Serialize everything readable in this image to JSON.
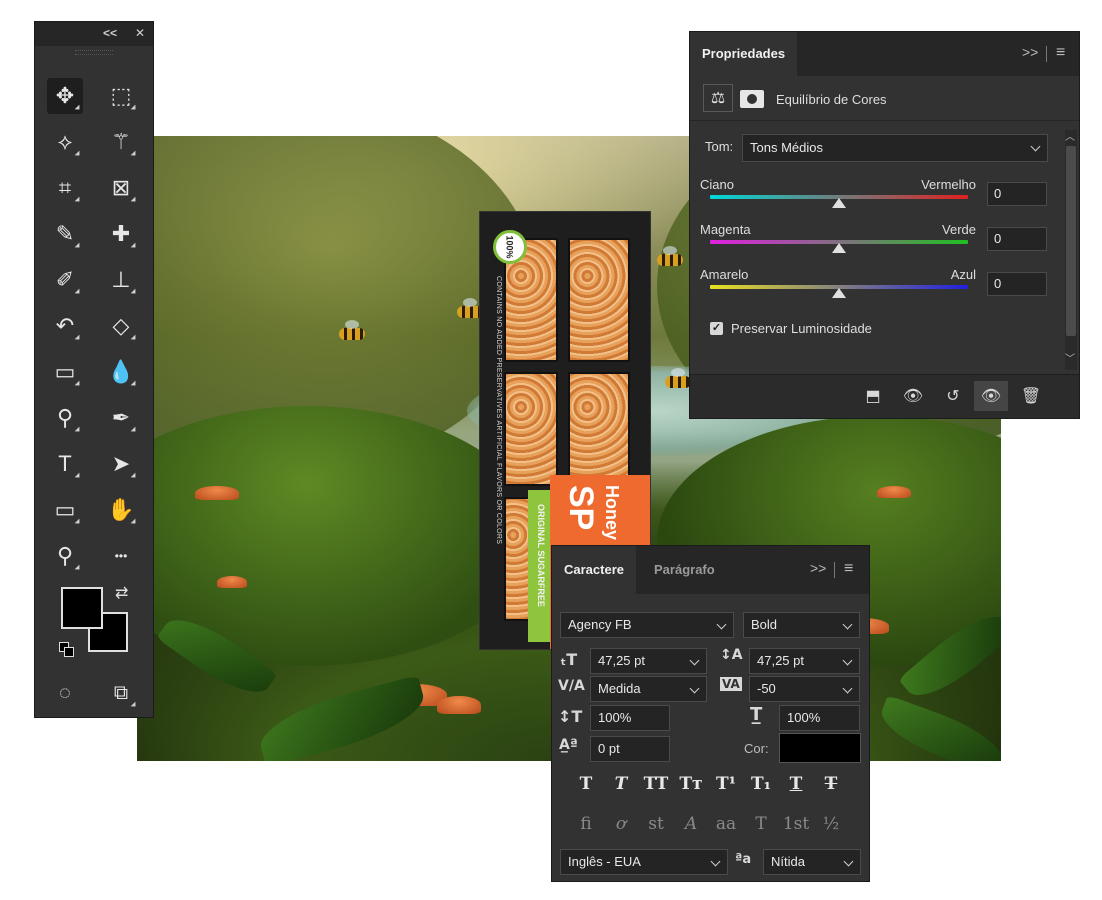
{
  "toolbar": {
    "collapse_glyph": "<<",
    "close_glyph": "✕",
    "tools": [
      {
        "name": "move-tool",
        "icon": "move-icon",
        "glyph": "✥",
        "active": true
      },
      {
        "name": "rectangular-marquee-tool",
        "icon": "marquee-icon",
        "glyph": "⬚"
      },
      {
        "name": "polygonal-lasso-tool",
        "icon": "lasso-icon",
        "glyph": "⟡"
      },
      {
        "name": "magic-wand-tool",
        "icon": "magic-wand-icon",
        "glyph": "⚚"
      },
      {
        "name": "crop-tool",
        "icon": "crop-icon",
        "glyph": "⌗"
      },
      {
        "name": "frame-tool",
        "icon": "frame-icon",
        "glyph": "⊠"
      },
      {
        "name": "eyedropper-tool",
        "icon": "eyedropper-icon",
        "glyph": "✎"
      },
      {
        "name": "healing-brush-tool",
        "icon": "bandage-icon",
        "glyph": "✚"
      },
      {
        "name": "brush-tool",
        "icon": "brush-icon",
        "glyph": "✐"
      },
      {
        "name": "clone-stamp-tool",
        "icon": "stamp-icon",
        "glyph": "⊥"
      },
      {
        "name": "history-brush-tool",
        "icon": "history-brush-icon",
        "glyph": "↶"
      },
      {
        "name": "eraser-tool",
        "icon": "eraser-icon",
        "glyph": "◇"
      },
      {
        "name": "gradient-tool",
        "icon": "gradient-icon",
        "glyph": "▭"
      },
      {
        "name": "blur-tool",
        "icon": "drop-icon",
        "glyph": "💧"
      },
      {
        "name": "dodge-tool",
        "icon": "dodge-icon",
        "glyph": "⚲"
      },
      {
        "name": "pen-tool",
        "icon": "pen-icon",
        "glyph": "✒"
      },
      {
        "name": "type-tool",
        "icon": "type-icon",
        "glyph": "T"
      },
      {
        "name": "path-selection-tool",
        "icon": "arrow-icon",
        "glyph": "➤"
      },
      {
        "name": "rectangle-tool",
        "icon": "rectangle-icon",
        "glyph": "▭"
      },
      {
        "name": "hand-tool",
        "icon": "hand-icon",
        "glyph": "✋"
      },
      {
        "name": "zoom-tool",
        "icon": "zoom-icon",
        "glyph": "⚲"
      },
      {
        "name": "more-tools",
        "icon": "ellipsis-icon",
        "glyph": "•••"
      }
    ],
    "foreground_color": "#000000",
    "background_color": "#000000",
    "swap_glyph": "⇄",
    "quick_mask_glyph": "◌",
    "screen_mode_glyph": "⧉"
  },
  "properties": {
    "tab_label": "Propriedades",
    "expand_glyph": ">>",
    "menu_glyph": "≡",
    "adjustment_title": "Equilíbrio de Cores",
    "tone_label": "Tom:",
    "tone_value": "Tons Médios",
    "sliders": [
      {
        "left": "Ciano",
        "right": "Vermelho",
        "value": "0",
        "gradient": [
          "#00d8d8",
          "#e02020"
        ],
        "position": 0.5
      },
      {
        "left": "Magenta",
        "right": "Verde",
        "value": "0",
        "gradient": [
          "#e020e0",
          "#20c020"
        ],
        "position": 0.5
      },
      {
        "left": "Amarelo",
        "right": "Azul",
        "value": "0",
        "gradient": [
          "#e8e020",
          "#2020e0"
        ],
        "position": 0.5
      }
    ],
    "preserve_label": "Preservar Luminosidade",
    "preserve_checked": true
  },
  "character": {
    "tabs": [
      "Caractere",
      "Parágrafo"
    ],
    "expand_glyph": ">>",
    "menu_glyph": "≡",
    "font_family": "Agency FB",
    "font_style": "Bold",
    "font_size": "47,25 pt",
    "leading": "47,25 pt",
    "kerning": "Medida",
    "tracking": "-50",
    "vertical_scale": "100%",
    "horizontal_scale": "100%",
    "baseline_shift": "0 pt",
    "color_label": "Cor:",
    "color_value": "#000000",
    "style_buttons_row1": [
      "T",
      "T",
      "TT",
      "Tт",
      "T¹",
      "T₁",
      "T",
      "T"
    ],
    "style_buttons_row2": [
      "fi",
      "ơ",
      "st",
      "A",
      "aa",
      "T",
      "1st",
      "½"
    ],
    "language": "Inglês - EUA",
    "aa_glyph": "ªa",
    "antialias": "Nítida"
  },
  "artwork": {
    "product_side_text": "CONTAINS NO ADDED PRESERVATIVES ARTIFICIAL FLAVORS OR COLORS",
    "badge_text": "100%",
    "brand_word_1": "Honey",
    "brand_word_2": "SP",
    "variant_text": "ORIGINAL SUGARFREE"
  }
}
